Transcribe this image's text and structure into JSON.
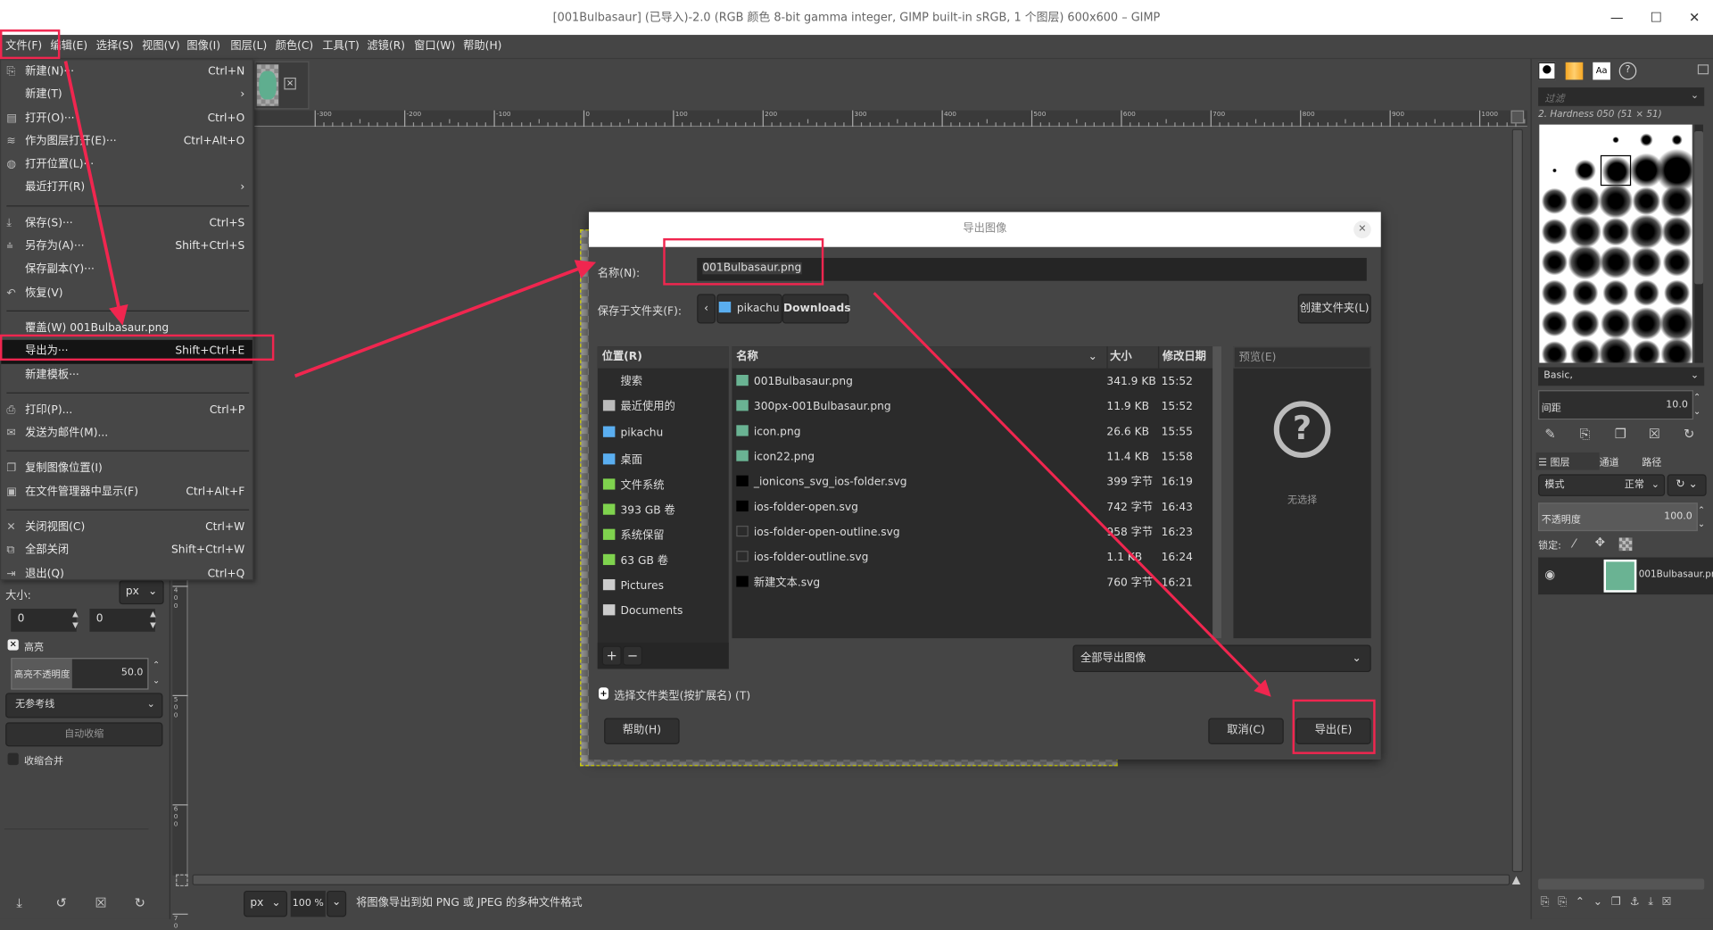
{
  "window": {
    "title": "[001Bulbasaur] (已导入)-2.0 (RGB 颜色 8-bit gamma integer, GIMP built-in sRGB, 1 个图层) 600x600 – GIMP",
    "minimize": "—",
    "maximize": "☐",
    "close": "✕"
  },
  "menubar": [
    "文件(F)",
    "编辑(E)",
    "选择(S)",
    "视图(V)",
    "图像(I)",
    "图层(L)",
    "颜色(C)",
    "工具(T)",
    "滤镜(R)",
    "窗口(W)",
    "帮助(H)"
  ],
  "file_menu": {
    "groups": [
      [
        {
          "label": "新建(N)···",
          "shortcut": "Ctrl+N",
          "icon": "new-icon"
        },
        {
          "label": "新建(T)",
          "shortcut": "›",
          "icon": ""
        },
        {
          "label": "打开(O)···",
          "shortcut": "Ctrl+O",
          "icon": "open-icon"
        },
        {
          "label": "作为图层打开(E)···",
          "shortcut": "Ctrl+Alt+O",
          "icon": "layers-icon"
        },
        {
          "label": "打开位置(L)···",
          "shortcut": "",
          "icon": "globe-icon"
        },
        {
          "label": "最近打开(R)",
          "shortcut": "›",
          "icon": ""
        }
      ],
      [
        {
          "label": "保存(S)···",
          "shortcut": "Ctrl+S",
          "icon": "save-icon"
        },
        {
          "label": "另存为(A)···",
          "shortcut": "Shift+Ctrl+S",
          "icon": "save-as-icon"
        },
        {
          "label": "保存副本(Y)···",
          "shortcut": "",
          "icon": ""
        },
        {
          "label": "恢复(V)",
          "shortcut": "",
          "icon": "revert-icon"
        }
      ],
      [
        {
          "label": "覆盖(W) 001Bulbasaur.png",
          "shortcut": "",
          "icon": ""
        },
        {
          "label": "导出为···",
          "shortcut": "Shift+Ctrl+E",
          "icon": "",
          "highlighted": true
        },
        {
          "label": "新建模板···",
          "shortcut": "",
          "icon": ""
        }
      ],
      [
        {
          "label": "打印(P)...",
          "shortcut": "Ctrl+P",
          "icon": "print-icon"
        },
        {
          "label": "发送为邮件(M)...",
          "shortcut": "",
          "icon": "mail-icon"
        }
      ],
      [
        {
          "label": "复制图像位置(I)",
          "shortcut": "",
          "icon": "copy-icon"
        },
        {
          "label": "在文件管理器中显示(F)",
          "shortcut": "Ctrl+Alt+F",
          "icon": "folder-icon"
        }
      ],
      [
        {
          "label": "关闭视图(C)",
          "shortcut": "Ctrl+W",
          "icon": "close-icon"
        },
        {
          "label": "全部关闭",
          "shortcut": "Shift+Ctrl+W",
          "icon": "close-all-icon"
        },
        {
          "label": "退出(Q)",
          "shortcut": "Ctrl+Q",
          "icon": "quit-icon"
        }
      ]
    ]
  },
  "ruler_ticks": [
    "-300",
    "-200",
    "-100",
    "0",
    "100",
    "200",
    "300",
    "400",
    "500",
    "600",
    "700",
    "800",
    "900",
    "1000"
  ],
  "vruler_ticks": [
    "400",
    "500",
    "600",
    "70"
  ],
  "tool_options": {
    "size_label": "大小:",
    "unit": "px",
    "w": "0",
    "h": "0",
    "highlight_label": "高亮",
    "highlight_checked": true,
    "highlight_opacity_label": "高亮不透明度",
    "highlight_opacity": "50.0",
    "guides": "无参考线",
    "auto_shrink": "自动收缩",
    "shrink_merged": "收缩合并"
  },
  "status": {
    "unit": "px",
    "zoom": "100 %",
    "message": "将图像导出到如 PNG 或 JPEG 的多种文件格式"
  },
  "dialog": {
    "title": "导出图像",
    "name_label": "名称(N):",
    "name_value": "001Bulbasaur.png",
    "folder_label": "保存于文件夹(F):",
    "path": [
      "pikachu",
      "Downloads"
    ],
    "create_folder": "创建文件夹(L)",
    "places_header": "位置(R)",
    "places": [
      {
        "label": "搜索",
        "icon": "search-icon"
      },
      {
        "label": "最近使用的",
        "icon": "recent-icon"
      },
      {
        "label": "pikachu",
        "icon": "home-icon"
      },
      {
        "label": "桌面",
        "icon": "desktop-icon"
      },
      {
        "label": "文件系统",
        "icon": "drive-icon"
      },
      {
        "label": "393 GB 卷",
        "icon": "drive-icon"
      },
      {
        "label": "系统保留",
        "icon": "drive-icon"
      },
      {
        "label": "63 GB 卷",
        "icon": "drive-icon"
      },
      {
        "label": "Pictures",
        "icon": "folder-icon"
      },
      {
        "label": "Documents",
        "icon": "folder-icon"
      }
    ],
    "columns": [
      "名称",
      "大小",
      "修改日期"
    ],
    "files": [
      {
        "name": "001Bulbasaur.png",
        "size": "341.9 KB",
        "date": "15:52",
        "type": "image"
      },
      {
        "name": "300px-001Bulbasaur.png",
        "size": "11.9 KB",
        "date": "15:52",
        "type": "image"
      },
      {
        "name": "icon.png",
        "size": "26.6 KB",
        "date": "15:55",
        "type": "image"
      },
      {
        "name": "icon22.png",
        "size": "11.4 KB",
        "date": "15:58",
        "type": "image"
      },
      {
        "name": "_ionicons_svg_ios-folder.svg",
        "size": "399 字节",
        "date": "16:19",
        "type": "svg-dark"
      },
      {
        "name": "ios-folder-open.svg",
        "size": "742 字节",
        "date": "16:43",
        "type": "svg-dark"
      },
      {
        "name": "ios-folder-open-outline.svg",
        "size": "958 字节",
        "date": "16:23",
        "type": "svg-outline"
      },
      {
        "name": "ios-folder-outline.svg",
        "size": "1.1 KB",
        "date": "16:24",
        "type": "svg-outline"
      },
      {
        "name": "新建文本.svg",
        "size": "760 字节",
        "date": "16:21",
        "type": "svg-dark"
      }
    ],
    "preview_label": "预览(E)",
    "no_selection": "无选择",
    "filter": "全部导出图像",
    "file_type_expander": "选择文件类型(按扩展名) (T)",
    "help": "帮助(H)",
    "cancel": "取消(C)",
    "export": "导出(E)"
  },
  "brushes": {
    "filter_placeholder": "过滤",
    "current": "2. Hardness 050 (51 × 51)",
    "tag": "Basic,",
    "spacing_label": "间距",
    "spacing": "10.0"
  },
  "layers": {
    "tabs": [
      "图层",
      "通道",
      "路径"
    ],
    "mode_label": "模式",
    "mode": "正常",
    "opacity_label": "不透明度",
    "opacity": "100.0",
    "lock_label": "锁定:",
    "layer_name": "001Bulbasaur.png"
  },
  "colors": {
    "annotation": "#f0264f",
    "highlight": "#141414"
  }
}
